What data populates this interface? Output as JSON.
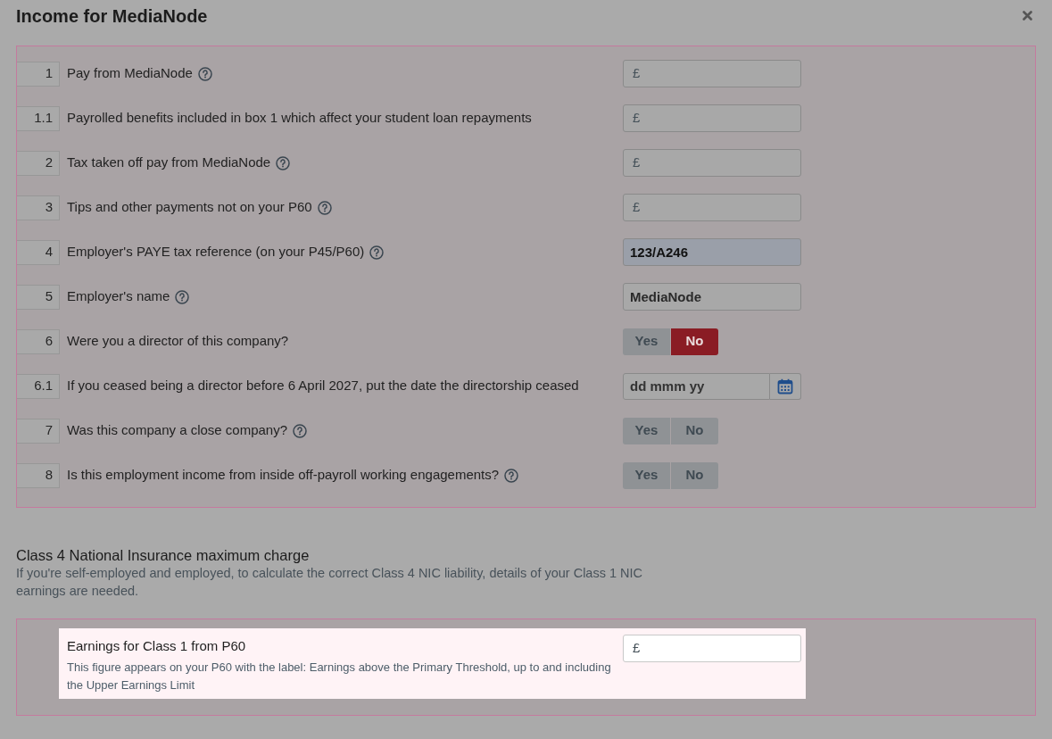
{
  "title": "Income for MediaNode",
  "questions": [
    {
      "number": "1",
      "label": "Pay from MediaNode",
      "help": true,
      "kind": "amount",
      "prefix": "£"
    },
    {
      "number": "1.1",
      "label": "Payrolled benefits included in box 1 which affect your student loan repayments",
      "help": false,
      "kind": "amount",
      "prefix": "£"
    },
    {
      "number": "2",
      "label": "Tax taken off pay from MediaNode",
      "help": true,
      "kind": "amount",
      "prefix": "£"
    },
    {
      "number": "3",
      "label": "Tips and other payments not on your P60",
      "help": true,
      "kind": "amount",
      "prefix": "£"
    },
    {
      "number": "4",
      "label": "Employer's PAYE tax reference (on your P45/P60)",
      "help": true,
      "kind": "text",
      "value": "123/A246",
      "highlighted": true
    },
    {
      "number": "5",
      "label": "Employer's name",
      "help": true,
      "kind": "text",
      "value": "MediaNode",
      "highlighted": false
    },
    {
      "number": "6",
      "label": "Were you a director of this company?",
      "help": false,
      "kind": "choice",
      "options": [
        {
          "label": "Yes",
          "selected": false
        },
        {
          "label": "No",
          "selected": true
        }
      ]
    },
    {
      "number": "6.1",
      "label": "If you ceased being a director before 6 April 2027, put the date the directorship ceased",
      "help": false,
      "kind": "date",
      "placeholder": "dd mmm yy"
    },
    {
      "number": "7",
      "label": "Was this company a close company?",
      "help": true,
      "kind": "choice",
      "options": [
        {
          "label": "Yes",
          "selected": false
        },
        {
          "label": "No",
          "selected": false
        }
      ]
    },
    {
      "number": "8",
      "label": "Is this employment income from inside off-payroll working engagements?",
      "help": true,
      "kind": "choice",
      "options": [
        {
          "label": "Yes",
          "selected": false
        },
        {
          "label": "No",
          "selected": false
        }
      ]
    }
  ],
  "class4": {
    "heading": "Class 4 National Insurance maximum charge",
    "description": "If you're self-employed and employed, to calculate the correct Class 4 NIC liability, details of your Class 1 NIC earnings are needed.",
    "fields": [
      {
        "label": "Earnings for Class 1 from P60",
        "hint": "This figure appears on your P60 with the label: Earnings above the Primary Threshold, up to and including the Upper Earnings Limit",
        "prefix": "£",
        "highlighted": true
      }
    ]
  }
}
